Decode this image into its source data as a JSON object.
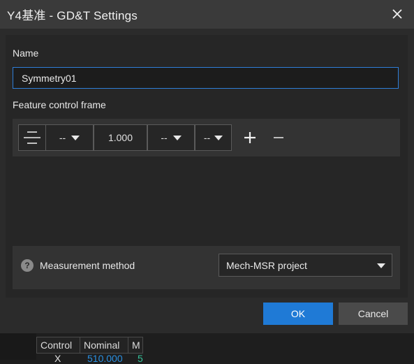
{
  "dialog": {
    "title": "Y4基准 - GD&T Settings",
    "name_label": "Name",
    "name_value": "Symmetry01",
    "fcf_label": "Feature control frame",
    "fcf": {
      "symbol": "symmetry-icon",
      "modifier_1": "--",
      "tolerance": "1.000",
      "modifier_2": "--",
      "datum": "--"
    },
    "measurement_label": "Measurement method",
    "measurement_value": "Mech-MSR project",
    "ok_label": "OK",
    "cancel_label": "Cancel"
  },
  "background_table": {
    "headers": [
      "Control",
      "Nominal",
      "M"
    ],
    "row": {
      "control": "X",
      "nominal": "510.000",
      "m": "5"
    }
  },
  "colors": {
    "accent": "#1f7ad6",
    "input_border": "#2f7ed8",
    "nominal_text": "#2a8fe0",
    "m_text": "#35c29a"
  }
}
